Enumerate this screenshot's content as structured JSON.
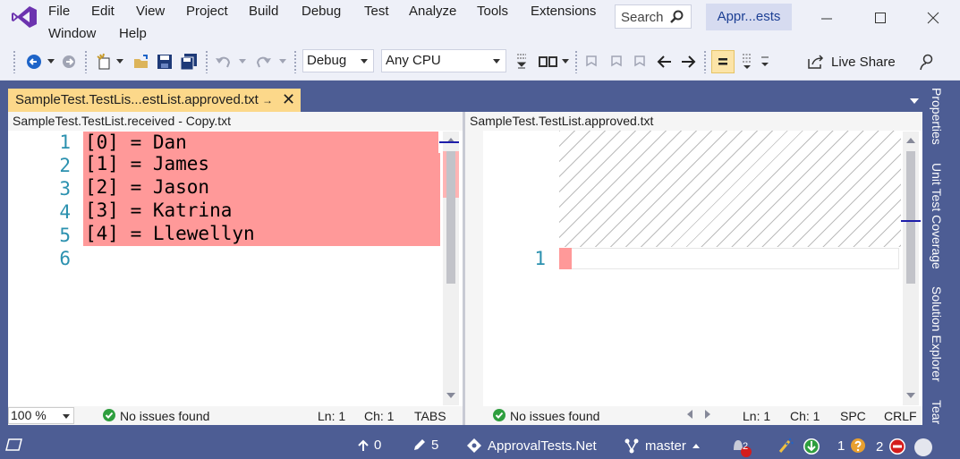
{
  "menu": {
    "file": "File",
    "edit": "Edit",
    "view": "View",
    "project": "Project",
    "build": "Build",
    "debug": "Debug",
    "test": "Test",
    "analyze": "Analyze",
    "tools": "Tools",
    "extensions": "Extensions",
    "window": "Window",
    "help": "Help"
  },
  "search": {
    "label": "Search"
  },
  "solution_badge": "Appr...ests",
  "toolbar": {
    "configuration": "Debug",
    "platform": "Any CPU",
    "live_share": "Live Share"
  },
  "document_tab": {
    "title": "SampleTest.TestLis...estList.approved.txt"
  },
  "left_editor": {
    "path": "SampleTest.TestList.received - Copy.txt",
    "line_numbers": [
      "1",
      "2",
      "3",
      "4",
      "5",
      "6"
    ],
    "lines": [
      "[0] = Dan",
      "[1] = James",
      "[2] = Jason",
      "[3] = Katrina",
      "[4] = Llewellyn"
    ],
    "zoom": "100 %",
    "issues": "No issues found",
    "ln": "Ln: 1",
    "ch": "Ch: 1",
    "indent": "TABS"
  },
  "right_editor": {
    "path": "SampleTest.TestList.approved.txt",
    "line_numbers": [
      "1"
    ],
    "issues": "No issues found",
    "ln": "Ln: 1",
    "ch": "Ch: 1",
    "indent": "SPC",
    "eol": "CRLF"
  },
  "side_tabs": {
    "properties": "Properties",
    "unit_test_coverage": "Unit Test Coverage",
    "solution_explorer": "Solution Explorer",
    "team": "Tear"
  },
  "status": {
    "push_count": "0",
    "pending_changes": "5",
    "repo": "ApprovalTests.Net",
    "branch": "master",
    "notification_count": "2",
    "errors_count": "1",
    "warnings_count": "2"
  },
  "colors": {
    "accent": "#4d5d94",
    "diff_removed": "#ff9999",
    "tab_active": "#fcd88a",
    "line_number": "#2b91af"
  }
}
